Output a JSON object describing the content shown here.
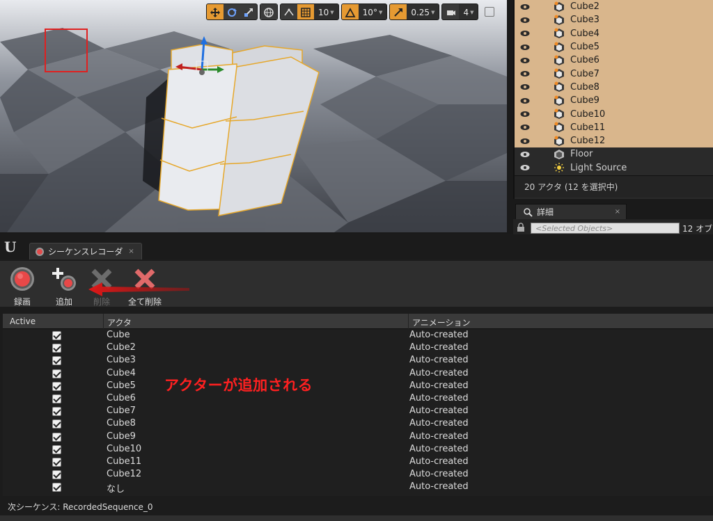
{
  "viewport": {
    "toolbar": {
      "grid_snap_value": "10",
      "rotation_snap_value": "10°",
      "scale_snap_value": "0.25",
      "camera_speed_value": "4"
    }
  },
  "outliner": {
    "items": [
      {
        "label": "Cube2",
        "selected": true,
        "icon": "static-mesh-actor-icon"
      },
      {
        "label": "Cube3",
        "selected": true,
        "icon": "static-mesh-actor-icon"
      },
      {
        "label": "Cube4",
        "selected": true,
        "icon": "static-mesh-actor-icon"
      },
      {
        "label": "Cube5",
        "selected": true,
        "icon": "static-mesh-actor-icon"
      },
      {
        "label": "Cube6",
        "selected": true,
        "icon": "static-mesh-actor-icon"
      },
      {
        "label": "Cube7",
        "selected": true,
        "icon": "static-mesh-actor-icon"
      },
      {
        "label": "Cube8",
        "selected": true,
        "icon": "static-mesh-actor-icon"
      },
      {
        "label": "Cube9",
        "selected": true,
        "icon": "static-mesh-actor-icon"
      },
      {
        "label": "Cube10",
        "selected": true,
        "icon": "static-mesh-actor-icon"
      },
      {
        "label": "Cube11",
        "selected": true,
        "icon": "static-mesh-actor-icon"
      },
      {
        "label": "Cube12",
        "selected": true,
        "icon": "static-mesh-actor-icon"
      },
      {
        "label": "Floor",
        "selected": false,
        "icon": "static-mesh-actor-icon"
      },
      {
        "label": "Light Source",
        "selected": false,
        "icon": "light-icon"
      }
    ],
    "footer": "20 アクタ (12 を選択中)"
  },
  "details": {
    "tab_label": "詳細",
    "tab_close": "×",
    "search_placeholder": "<Selected Objects>",
    "count": "12 オブ"
  },
  "recorder": {
    "tab_label": "シーケンスレコーダ",
    "tab_close": "×",
    "buttons": {
      "record": "録画",
      "add": "追加",
      "remove": "削除",
      "remove_all": "全て削除"
    },
    "columns": {
      "active": "Active",
      "actor": "アクタ",
      "animation": "アニメーション"
    },
    "rows": [
      {
        "actor": "Cube",
        "animation": "Auto-created"
      },
      {
        "actor": "Cube2",
        "animation": "Auto-created"
      },
      {
        "actor": "Cube3",
        "animation": "Auto-created"
      },
      {
        "actor": "Cube4",
        "animation": "Auto-created"
      },
      {
        "actor": "Cube5",
        "animation": "Auto-created"
      },
      {
        "actor": "Cube6",
        "animation": "Auto-created"
      },
      {
        "actor": "Cube7",
        "animation": "Auto-created"
      },
      {
        "actor": "Cube8",
        "animation": "Auto-created"
      },
      {
        "actor": "Cube9",
        "animation": "Auto-created"
      },
      {
        "actor": "Cube10",
        "animation": "Auto-created"
      },
      {
        "actor": "Cube11",
        "animation": "Auto-created"
      },
      {
        "actor": "Cube12",
        "animation": "Auto-created"
      },
      {
        "actor": "なし",
        "animation": "Auto-created"
      }
    ],
    "next_sequence": "次シーケンス: RecordedSequence_0"
  },
  "annotation": "アクターが追加される",
  "colors": {
    "selection": "#d9b68c",
    "toolbar_active": "#e69a32",
    "highlight_red": "#e02020"
  }
}
